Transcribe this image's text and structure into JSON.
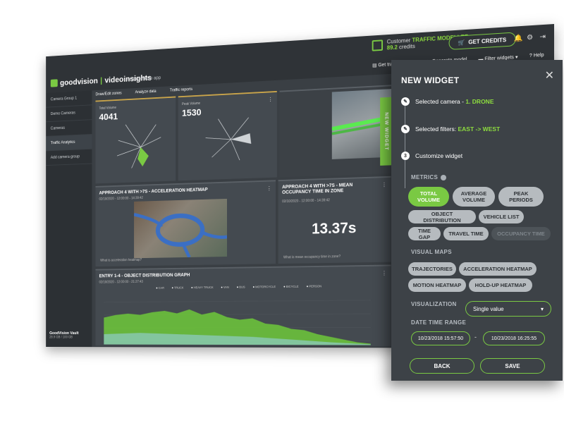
{
  "topbar": {
    "logo_brand": "goodvision",
    "logo_sep": "|",
    "logo_product": "videoinsights",
    "desktop_app": "Get desktop app",
    "customer_label": "Customer",
    "customer_plan": "TRAFFIC MODELLER",
    "credits_value": "89.2",
    "credits_word": "credits",
    "get_credits": "GET CREDITS",
    "actions": [
      "Get traffic report",
      "Generate model",
      "Filter widgets",
      "Help"
    ],
    "generate_badge": "2"
  },
  "sidebar": {
    "items": [
      "Camera Group 1",
      "Demo Cameras",
      "Cameras",
      "Traffic Analytics",
      "Add camera group"
    ],
    "vault_title": "GoodVision Vault",
    "vault_size": "28.9 GB / 100 GB"
  },
  "tabs": [
    "Draw/Edit zones",
    "Analyze data",
    "Traffic reports"
  ],
  "widgets": {
    "total_volume_1": {
      "label": "Total Volume",
      "value": "4041"
    },
    "peak_volume": {
      "label": "Peak Volume",
      "value": "1530"
    },
    "heatmap": {
      "title": "APPROACH 4 WITH >7S - ACCELERATION HEATMAP",
      "date": "02/10/2020 - 12:00:00 - 14:39:42",
      "question": "What is acceleration heatmap?"
    },
    "occupancy": {
      "title": "APPROACH 4 WITH >7S - MEAN OCCUPANCY TIME IN ZONE",
      "date": "02/10/2020 - 12:00:00 - 14:39:42",
      "value": "13.37s",
      "question": "What is mean occupancy time in zone?"
    },
    "distribution": {
      "title": "ENTRY 1-4 - OBJECT DISTRIBUTION GRAPH",
      "date": "02/10/2020 - 12:00:00 - 21:27:43",
      "legend": [
        "CAR",
        "TRUCK",
        "HEAVY TRUCK",
        "VAN",
        "BUS",
        "MOTORCYCLE",
        "BICYCLE",
        "PERSON"
      ]
    },
    "new_widget_tab": "NEW WIDGET"
  },
  "panel": {
    "title": "NEW WIDGET",
    "step1_prefix": "Selected camera - ",
    "step1_value": "1. DRONE",
    "step2_prefix": "Selected filters: ",
    "step2_value": "EAST -> WEST",
    "step3_num": "3",
    "step3_label": "Customize widget",
    "metrics_label": "METRICS",
    "metrics": [
      "TOTAL VOLUME",
      "AVERAGE VOLUME",
      "PEAK PERIODS",
      "OBJECT DISTRIBUTION",
      "VEHICLE LIST",
      "TIME GAP",
      "TRAVEL TIME",
      "OCCUPANCY TIME"
    ],
    "visual_maps_label": "VISUAL MAPS",
    "visual_maps": [
      "TRAJECTORIES",
      "ACCELERATION HEATMAP",
      "MOTION HEATMAP",
      "HOLD-UP HEATMAP"
    ],
    "visualization_label": "VISUALIZATION",
    "visualization_value": "Single value",
    "date_range_label": "DATE TIME RANGE",
    "date_from": "10/23/2018 15:57:50",
    "date_sep": "-",
    "date_to": "10/23/2018 16:25:55",
    "back": "BACK",
    "save": "SAVE"
  },
  "colors": {
    "accent": "#7ac943",
    "panel_bg": "#3d4247",
    "dash_bg": "#3a3f44"
  }
}
